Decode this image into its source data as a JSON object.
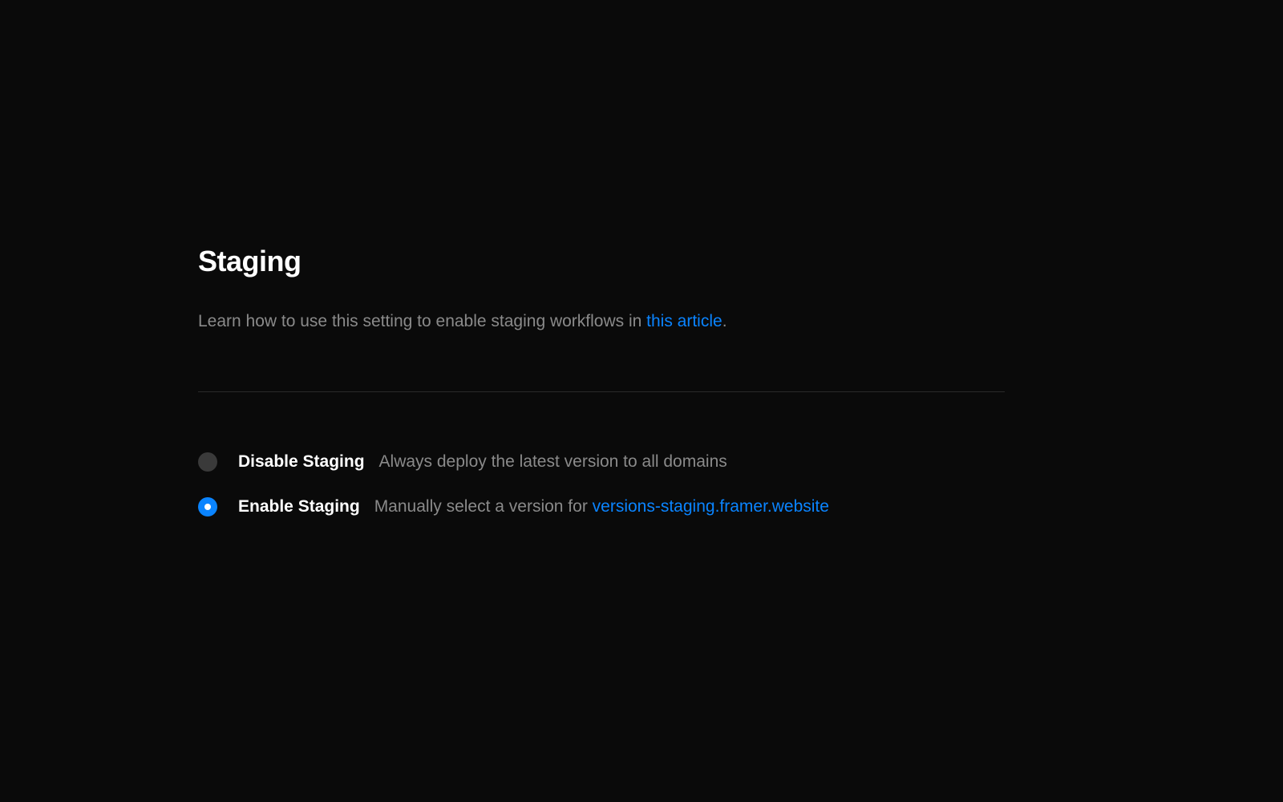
{
  "heading": "Staging",
  "description": {
    "prefix": "Learn how to use this setting to enable staging workflows in ",
    "link_text": "this article",
    "suffix": "."
  },
  "options": [
    {
      "selected": false,
      "label": "Disable Staging",
      "desc_prefix": "Always deploy the latest version to all domains",
      "desc_link": "",
      "desc_suffix": ""
    },
    {
      "selected": true,
      "label": "Enable Staging",
      "desc_prefix": "Manually select a version for ",
      "desc_link": "versions-staging.framer.website",
      "desc_suffix": ""
    }
  ]
}
